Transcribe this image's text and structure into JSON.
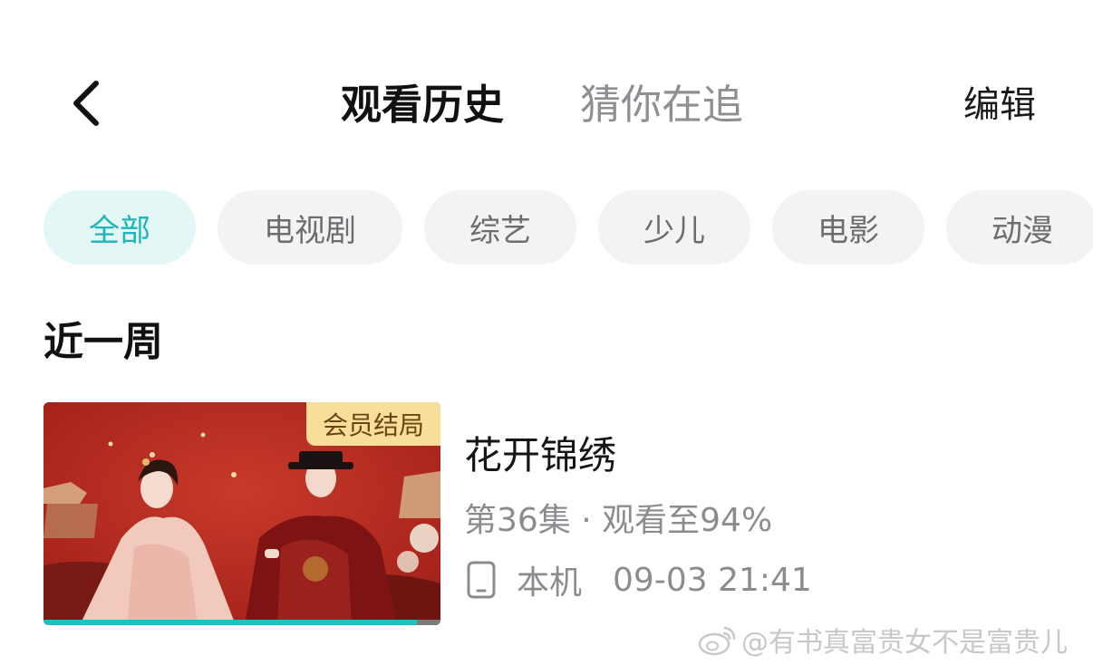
{
  "header": {
    "tabs": [
      {
        "label": "观看历史",
        "active": true
      },
      {
        "label": "猜你在追",
        "active": false
      }
    ],
    "edit_label": "编辑"
  },
  "filters": [
    {
      "label": "全部",
      "active": true
    },
    {
      "label": "电视剧",
      "active": false
    },
    {
      "label": "综艺",
      "active": false
    },
    {
      "label": "少儿",
      "active": false
    },
    {
      "label": "电影",
      "active": false
    },
    {
      "label": "动漫",
      "active": false
    }
  ],
  "section": {
    "title": "近一周"
  },
  "history": [
    {
      "title": "花开锦绣",
      "badge": "会员结局",
      "episode_progress": "第36集 · 观看至94%",
      "progress_fraction": 0.94,
      "device": "本机",
      "time": "09-03 21:41"
    }
  ],
  "watermark": "@有书真富贵女不是富贵儿",
  "colors": {
    "accent": "#1db5b8",
    "chip_active_bg": "#e4f7f7",
    "chip_bg": "#f3f3f4",
    "vip_badge_bg": "#f7df9a",
    "progress": "#1fc0c1"
  },
  "icons": {
    "back": "chevron-left-icon",
    "device": "phone-icon",
    "watermark": "weibo-icon"
  }
}
